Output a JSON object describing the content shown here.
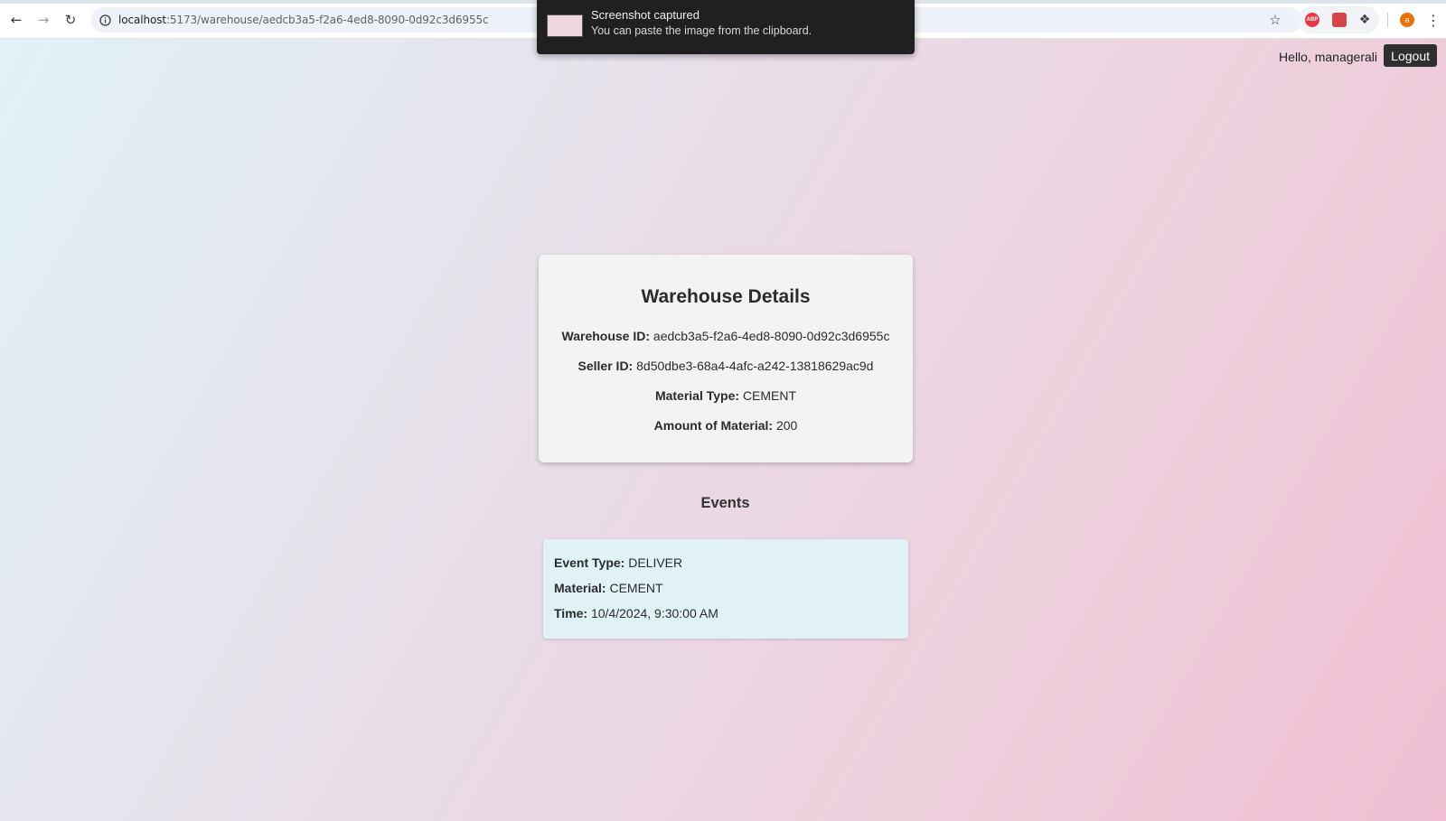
{
  "browser": {
    "url_host": "localhost",
    "url_path": ":5173/warehouse/aedcb3a5-f2a6-4ed8-8090-0d92c3d6955c",
    "profile_initial": "a",
    "abp_label": "ABP"
  },
  "toast": {
    "title": "Screenshot captured",
    "subtitle": "You can paste the image from the clipboard."
  },
  "header": {
    "greeting": "Hello, managerali",
    "logout_label": "Logout"
  },
  "warehouse": {
    "title": "Warehouse Details",
    "fields": [
      {
        "label": "Warehouse ID:",
        "value": "aedcb3a5-f2a6-4ed8-8090-0d92c3d6955c"
      },
      {
        "label": "Seller ID:",
        "value": "8d50dbe3-68a4-4afc-a242-13818629ac9d"
      },
      {
        "label": "Material Type:",
        "value": "CEMENT"
      },
      {
        "label": "Amount of Material:",
        "value": "200"
      }
    ]
  },
  "events": {
    "title": "Events",
    "items": [
      {
        "type_label": "Event Type:",
        "type_value": "DELIVER",
        "material_label": "Material:",
        "material_value": "CEMENT",
        "time_label": "Time:",
        "time_value": "10/4/2024, 9:30:00 AM"
      }
    ]
  },
  "colors": {
    "gradient_start": "#e0f2f6",
    "gradient_end": "#f0bfd3",
    "event_card_bg": "#e0f2f6",
    "details_card_bg": "#f3f3f3",
    "logout_bg": "#2f2f2f"
  }
}
